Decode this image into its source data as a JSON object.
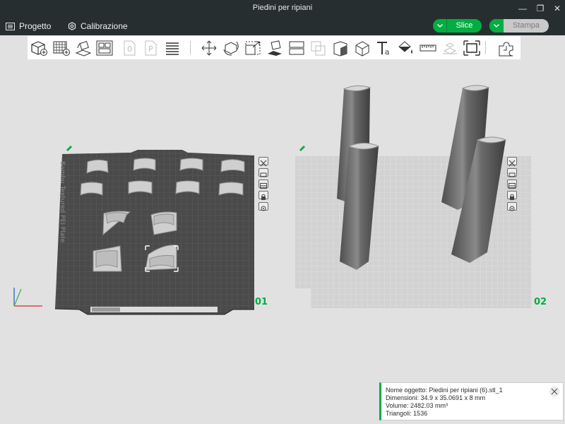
{
  "window": {
    "title": "Piedini per ripiani",
    "minimize_glyph": "—",
    "restore_glyph": "❐",
    "close_glyph": "✕"
  },
  "menu": {
    "project_label": "Progetto",
    "calibration_label": "Calibrazione",
    "slice_label": "Slice",
    "print_label": "Stampa"
  },
  "toolbar": {
    "tools": [
      "add-icon",
      "add-plate-icon",
      "auto-orient-icon",
      "arrange-icon",
      "plate-0-icon",
      "plate-p-icon",
      "layers-icon",
      "move-icon",
      "rotate-icon",
      "scale-icon",
      "lay-on-face-icon",
      "split-icon",
      "boolean-icon",
      "cut-icon",
      "support-paint-icon",
      "text-icon",
      "color-paint-icon",
      "measure-icon",
      "assembly-icon",
      "fit-view-icon",
      "puzzle-icon"
    ]
  },
  "plates": [
    {
      "number": "01",
      "label": "Bambu Textured PEI Plate"
    },
    {
      "number": "02"
    }
  ],
  "info": {
    "object_name": "Nome oggetto: Piedini per ripiani (6).stl_1",
    "dimensions": "Dimensioni: 34.9 x 35.0691 x 8 mm",
    "volume": "Volume: 2482.03 mm³",
    "triangles": "Triangoli: 1536"
  },
  "colors": {
    "accent": "#00ae42",
    "plate_dark": "#4a4a4a",
    "plate_light": "#d2d2d2",
    "background": "#e1e1e1",
    "menubar": "#262e30"
  }
}
